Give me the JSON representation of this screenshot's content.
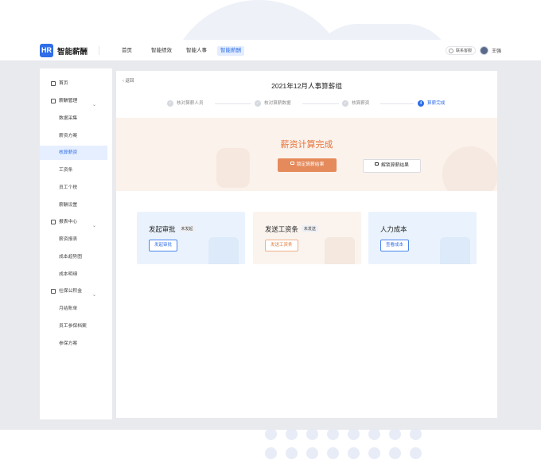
{
  "app": {
    "logo_mark": "HR",
    "name": "智能薪酬"
  },
  "topnav": [
    {
      "label": "首页",
      "active": false
    },
    {
      "label": "智能绩效",
      "active": false
    },
    {
      "label": "智能人事",
      "active": false
    },
    {
      "label": "智能薪酬",
      "active": true
    }
  ],
  "header": {
    "support_label": "联系客服",
    "user_name": "王强"
  },
  "sidebar": {
    "items": [
      {
        "label": "首页",
        "type": "group",
        "icon": "home-icon"
      },
      {
        "label": "薪酬管理",
        "type": "group",
        "icon": "wallet-icon",
        "expanded": true
      },
      {
        "label": "数据采集",
        "type": "sub"
      },
      {
        "label": "薪资方案",
        "type": "sub"
      },
      {
        "label": "核算薪资",
        "type": "sub",
        "active": true
      },
      {
        "label": "工资条",
        "type": "sub"
      },
      {
        "label": "员工个税",
        "type": "sub"
      },
      {
        "label": "薪酬设置",
        "type": "sub"
      },
      {
        "label": "报表中心",
        "type": "group",
        "icon": "report-icon",
        "expanded": true
      },
      {
        "label": "薪资报表",
        "type": "sub"
      },
      {
        "label": "成本趋势图",
        "type": "sub"
      },
      {
        "label": "成本明细",
        "type": "sub"
      },
      {
        "label": "社保公积金",
        "type": "group",
        "icon": "shield-icon",
        "expanded": true
      },
      {
        "label": "月结账单",
        "type": "sub"
      },
      {
        "label": "员工参保档案",
        "type": "sub"
      },
      {
        "label": "参保方案",
        "type": "sub"
      }
    ]
  },
  "main": {
    "back_label": "返回",
    "title": "2021年12月人事算薪组",
    "steps": [
      {
        "label": "核对算薪人员",
        "status": "done"
      },
      {
        "label": "核对算薪数据",
        "status": "done"
      },
      {
        "label": "核算薪资",
        "status": "done"
      },
      {
        "label": "算薪完成",
        "status": "current",
        "number": "4"
      }
    ],
    "banner": {
      "title": "薪资计算完成",
      "lock_button": "锁定算薪结果",
      "unlock_button": "解锁算薪结果"
    },
    "cards": [
      {
        "title": "发起审批",
        "badge": "未发起",
        "button": "发起审批",
        "style": "blue"
      },
      {
        "title": "发送工资条",
        "badge": "未发送",
        "button": "发送工资条",
        "style": "orange"
      },
      {
        "title": "人力成本",
        "badge": "",
        "button": "查看成本",
        "style": "blue"
      }
    ]
  },
  "colors": {
    "accent": "#2f6ee8",
    "orange": "#e58a5b"
  }
}
